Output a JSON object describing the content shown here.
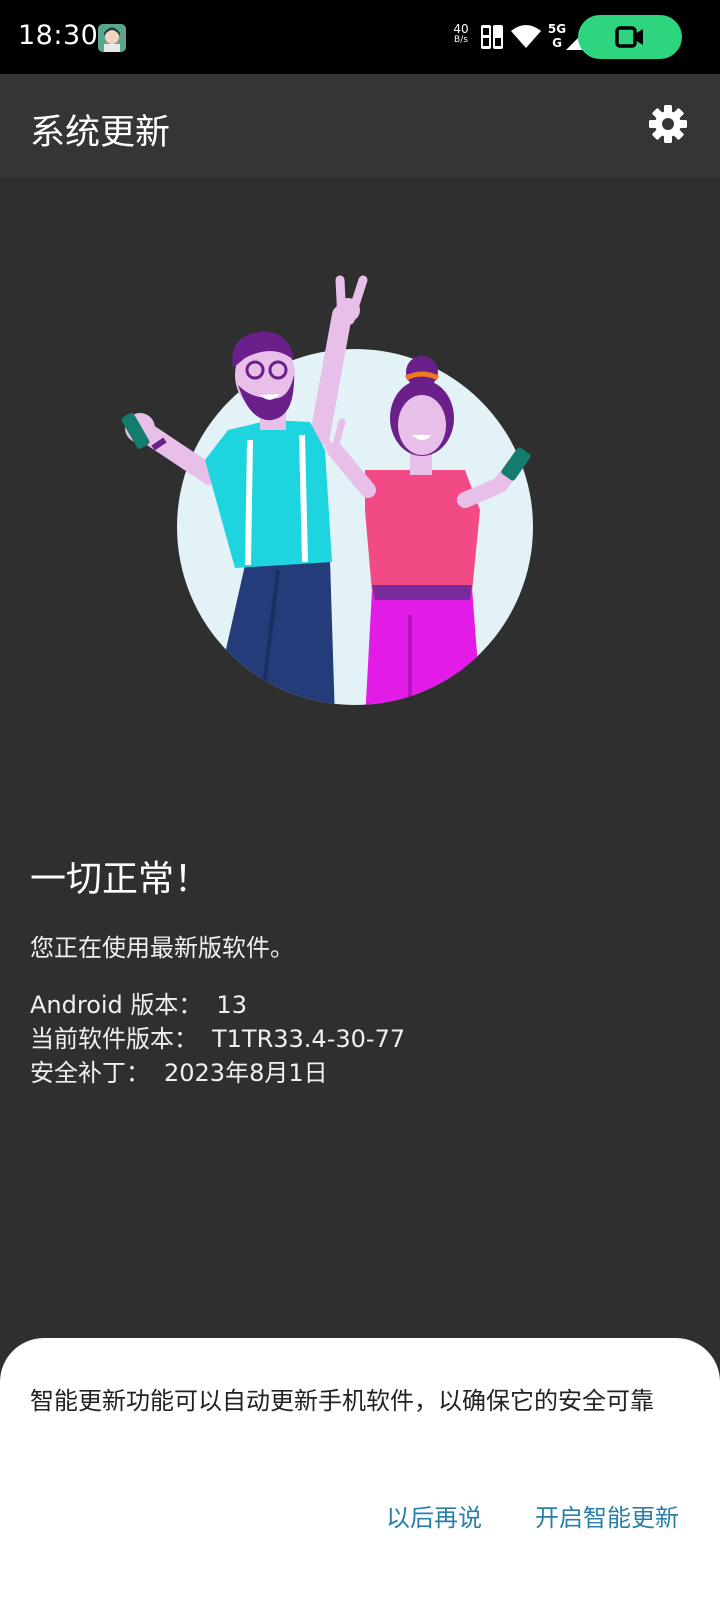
{
  "status_bar": {
    "time": "18:30",
    "net_speed": "40",
    "net_speed_unit": "B/s",
    "network_type_top": "5G",
    "network_type_bottom": "G"
  },
  "app_bar": {
    "title": "系统更新",
    "settings_icon": "gear-icon"
  },
  "status": {
    "headline": "一切正常！",
    "subtitle": "您正在使用最新版软件。"
  },
  "info": [
    {
      "label": "Android 版本：",
      "value": "13"
    },
    {
      "label": "当前软件版本：",
      "value": "T1TR33.4-30-77"
    },
    {
      "label": "安全补丁：",
      "value": "2023年8月1日"
    }
  ],
  "sheet": {
    "message": "智能更新功能可以自动更新手机软件，以确保它的安全可靠",
    "later_label": "以后再说",
    "enable_label": "开启智能更新"
  },
  "colors": {
    "background": "#2f2f2f",
    "app_bar": "#353535",
    "accent_link": "#2a7fa8",
    "recording_pill": "#2fd47e"
  }
}
